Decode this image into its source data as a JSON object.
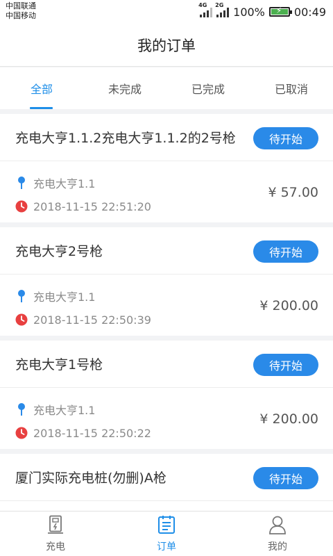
{
  "status_bar": {
    "carrier1": "中国联通",
    "carrier2": "中国移动",
    "net1": "4G",
    "net2": "2G",
    "battery": "100%",
    "time": "00:49"
  },
  "header": {
    "title": "我的订单"
  },
  "tabs": [
    {
      "label": "全部",
      "active": true
    },
    {
      "label": "未完成",
      "active": false
    },
    {
      "label": "已完成",
      "active": false
    },
    {
      "label": "已取消",
      "active": false
    }
  ],
  "orders": [
    {
      "name": "充电大亨1.1.2充电大亨1.1.2的2号枪",
      "status": "待开始",
      "station": "充电大亨1.1",
      "time": "2018-11-15 22:51:20",
      "price": "¥ 57.00"
    },
    {
      "name": "充电大亨2号枪",
      "status": "待开始",
      "station": "充电大亨1.1",
      "time": "2018-11-15 22:50:39",
      "price": "¥ 200.00"
    },
    {
      "name": "充电大亨1号枪",
      "status": "待开始",
      "station": "充电大亨1.1",
      "time": "2018-11-15 22:50:22",
      "price": "¥ 200.00"
    },
    {
      "name": "厦门实际充电桩(勿删)A枪",
      "status": "待开始"
    }
  ],
  "bottom_nav": [
    {
      "label": "充电",
      "icon": "charging-pile-icon",
      "active": false
    },
    {
      "label": "订单",
      "icon": "order-list-icon",
      "active": true
    },
    {
      "label": "我的",
      "icon": "user-icon",
      "active": false
    }
  ],
  "colors": {
    "accent": "#1e8ee8",
    "button": "#2a8ae8",
    "clock": "#e84040",
    "pin": "#2a8ae8"
  }
}
